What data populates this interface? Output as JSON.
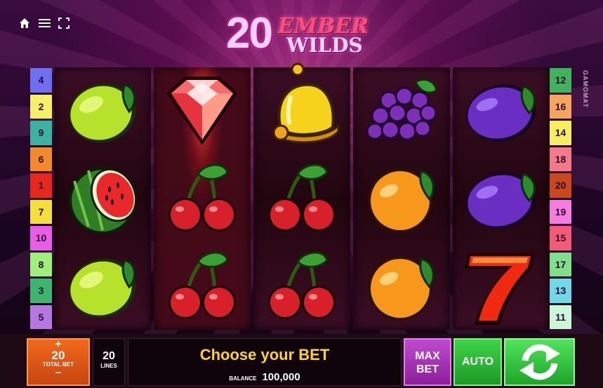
{
  "game": {
    "logo_number": "20",
    "logo_word1": "EMBER",
    "logo_word2": "WILDS",
    "brand": "GAMOMAT"
  },
  "top_icons": [
    "home-icon",
    "menu-icon",
    "fullscreen-icon"
  ],
  "paylines": {
    "left": [
      {
        "n": "4",
        "color": "#6f6ff2"
      },
      {
        "n": "2",
        "color": "#f6f067"
      },
      {
        "n": "9",
        "color": "#3ab3a2"
      },
      {
        "n": "6",
        "color": "#f38a2a"
      },
      {
        "n": "1",
        "color": "#e8281d"
      },
      {
        "n": "7",
        "color": "#f7df3a"
      },
      {
        "n": "10",
        "color": "#e85ce8"
      },
      {
        "n": "8",
        "color": "#9ff07a"
      },
      {
        "n": "3",
        "color": "#3bb66f"
      },
      {
        "n": "5",
        "color": "#b477e0"
      }
    ],
    "right": [
      {
        "n": "12",
        "color": "#3fb45c"
      },
      {
        "n": "16",
        "color": "#f7a55a"
      },
      {
        "n": "14",
        "color": "#f6ee5e"
      },
      {
        "n": "18",
        "color": "#f47a8a"
      },
      {
        "n": "20",
        "color": "#c9491d"
      },
      {
        "n": "19",
        "color": "#f57ce0"
      },
      {
        "n": "15",
        "color": "#f45a78"
      },
      {
        "n": "17",
        "color": "#7fe08a"
      },
      {
        "n": "13",
        "color": "#6fd9e7"
      },
      {
        "n": "11",
        "color": "#c9f7d8"
      }
    ]
  },
  "reels": [
    [
      "lime",
      "watermelon",
      "lime"
    ],
    [
      "diamond",
      "cherry",
      "cherry"
    ],
    [
      "bell",
      "cherry",
      "cherry"
    ],
    [
      "grapes",
      "orange",
      "orange"
    ],
    [
      "plum",
      "plum",
      "seven"
    ]
  ],
  "controls": {
    "plus": "+",
    "total_bet_value": "20",
    "total_bet_label": "TOTAL BET",
    "minus": "−",
    "lines_value": "20",
    "lines_label": "LINES",
    "message": "Choose your BET",
    "balance_label": "BALANCE",
    "balance_value": "100,000",
    "max_bet_1": "MAX",
    "max_bet_2": "BET",
    "auto_label": "AUTO"
  }
}
